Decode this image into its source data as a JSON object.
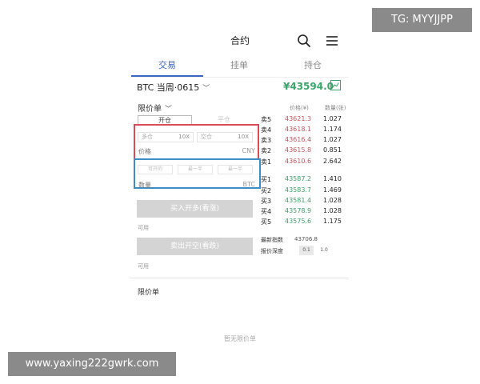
{
  "header": {
    "title": "合约",
    "search_icon": "search-icon",
    "menu_icon": "menu-icon"
  },
  "tabs": [
    {
      "label": "交易",
      "active": true
    },
    {
      "label": "挂单",
      "active": false
    },
    {
      "label": "持仓",
      "active": false
    }
  ],
  "contract": {
    "name": "BTC 当周·0615",
    "price": "¥43594.0"
  },
  "order_form": {
    "order_type": "限价单",
    "open_label": "开仓",
    "close_label": "平仓",
    "long_label": "多仓",
    "long_leverage": "10X",
    "short_label": "空仓",
    "short_leverage": "10X",
    "price_label": "价格",
    "price_unit": "CNY",
    "pct_options": [
      "可开的",
      "最一半",
      "最一半"
    ],
    "qty_label": "数量",
    "qty_unit": "BTC",
    "buy_button": "买入开多(看涨)",
    "sell_button": "卖出开空(看跌)",
    "avail_label_1": "可用",
    "avail_label_2": "可用"
  },
  "orderbook": {
    "price_header": "价格(¥)",
    "qty_header": "数量(张)",
    "asks": [
      {
        "label": "卖5",
        "price": "43621.3",
        "qty": "1.027"
      },
      {
        "label": "卖4",
        "price": "43618.1",
        "qty": "1.174"
      },
      {
        "label": "卖3",
        "price": "43616.4",
        "qty": "1.027"
      },
      {
        "label": "卖2",
        "price": "43615.8",
        "qty": "0.851"
      },
      {
        "label": "卖1",
        "price": "43610.6",
        "qty": "2.642"
      }
    ],
    "bids": [
      {
        "label": "买1",
        "price": "43587.2",
        "qty": "1.410"
      },
      {
        "label": "买2",
        "price": "43583.7",
        "qty": "1.469"
      },
      {
        "label": "买3",
        "price": "43581.4",
        "qty": "1.028"
      },
      {
        "label": "买4",
        "price": "43578.9",
        "qty": "1.028"
      },
      {
        "label": "买5",
        "price": "43575.6",
        "qty": "1.175"
      }
    ],
    "latest_label": "最新指数",
    "latest_value": "43706.8",
    "depth_label": "报价深度",
    "depth_options": [
      "0.1",
      "1.0"
    ]
  },
  "orders_section": {
    "title": "限价单",
    "empty_text": "暂无限价单"
  },
  "watermarks": {
    "top": "TG: MYYJJPP",
    "bottom": "www.yaxing222gwrk.com"
  },
  "colors": {
    "accent": "#3a66c4",
    "up": "#3aa56a",
    "down": "#c9545c",
    "highlight_red": "#d94b57",
    "highlight_blue": "#3d8ec4"
  }
}
